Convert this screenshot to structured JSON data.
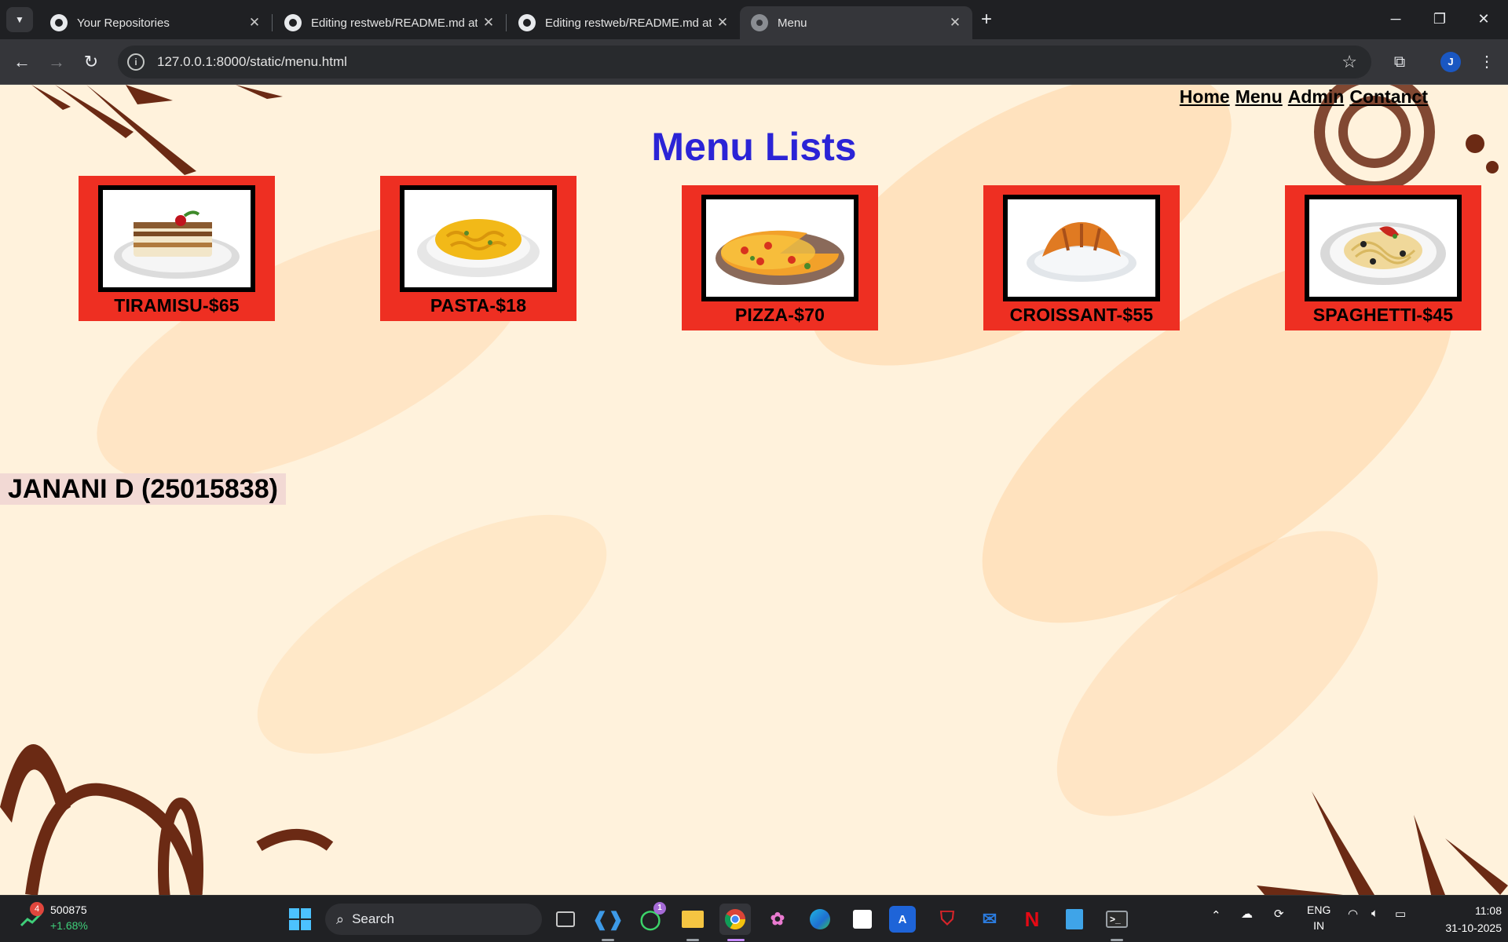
{
  "browser": {
    "tabs": [
      {
        "title": "Your Repositories",
        "active": false
      },
      {
        "title": "Editing restweb/README.md at",
        "active": false
      },
      {
        "title": "Editing restweb/README.md at",
        "active": false
      },
      {
        "title": "Menu",
        "active": true
      }
    ],
    "url": "127.0.0.1:8000/static/menu.html",
    "profile_initial": "J"
  },
  "page": {
    "nav": [
      "Home",
      "Menu",
      "Admin",
      "Contanct"
    ],
    "title": "Menu Lists",
    "items": [
      {
        "label": "TIRAMISU-$65",
        "dish": "tiramisu"
      },
      {
        "label": "PASTA-$18",
        "dish": "pasta"
      },
      {
        "label": "PIZZA-$70",
        "dish": "pizza"
      },
      {
        "label": "CROISSANT-$55",
        "dish": "croissant"
      },
      {
        "label": "SPAGHETTI-$45",
        "dish": "spaghetti"
      }
    ],
    "footer_name": "JANANI D (25015838)"
  },
  "taskbar": {
    "stock_badge": "4",
    "stock_value": "500875",
    "stock_change": "+1.68%",
    "search_label": "Search",
    "whatsapp_badge": "1",
    "lang_top": "ENG",
    "lang_bottom": "IN",
    "time": "11:08",
    "date": "31-10-2025"
  },
  "colors": {
    "page_bg": "#fff2dc",
    "card_red": "#ee2f22",
    "title_blue": "#2b24d6",
    "decor_brown": "#6b2a14"
  }
}
